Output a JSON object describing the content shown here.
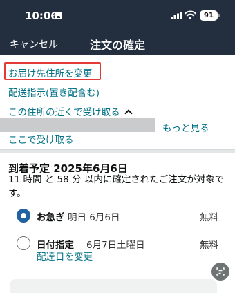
{
  "status_bar": {
    "time": "10:06",
    "battery": "91"
  },
  "header": {
    "cancel_label": "キャンセル",
    "title": "注文の確定"
  },
  "address_links": {
    "change_address": "お届け先住所を変更",
    "delivery_instructions": "配送指示(置き配含む)",
    "pickup_nearby": "この住所の近くで受け取る",
    "see_more": "もっと見る",
    "pickup_here": "ここで受け取る"
  },
  "delivery": {
    "heading": "到着予定 2025年6月6日",
    "note": "11 時間 と 58 分 以内に確定されたご注文が対象です。",
    "options": [
      {
        "name": "お急ぎ",
        "date": "明日 6月6日",
        "price": "無料",
        "selected": true
      },
      {
        "name": "日付指定",
        "date": "6月7日土曜日",
        "price": "無料",
        "selected": false,
        "change_link": "配達日を変更"
      }
    ]
  },
  "colors": {
    "header_bg": "#232f3e",
    "link": "#007185",
    "radio_selected": "#2162a1",
    "highlight_box": "#e53935"
  }
}
